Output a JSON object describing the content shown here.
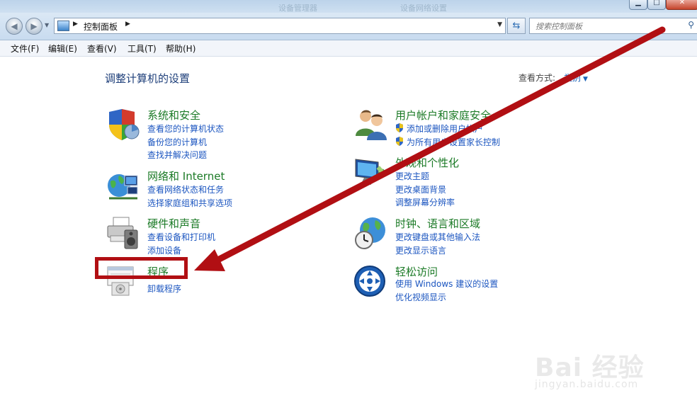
{
  "titlebar": {
    "ghost_left": "设备管理器",
    "ghost_right": "设备网络设置"
  },
  "address": {
    "crumb": "控制面板",
    "search_placeholder": "搜索控制面板"
  },
  "menus": [
    "文件(F)",
    "编辑(E)",
    "查看(V)",
    "工具(T)",
    "帮助(H)"
  ],
  "page": {
    "title": "调整计算机的设置",
    "view_by_label": "查看方式:",
    "view_by_value": "类别"
  },
  "categories": [
    {
      "title": "系统和安全",
      "icon": "shield-icon",
      "links": [
        {
          "text": "查看您的计算机状态"
        },
        {
          "text": "备份您的计算机"
        },
        {
          "text": "查找并解决问题"
        }
      ]
    },
    {
      "title": "网络和 Internet",
      "icon": "network-globe-icon",
      "links": [
        {
          "text": "查看网络状态和任务"
        },
        {
          "text": "选择家庭组和共享选项"
        }
      ]
    },
    {
      "title": "硬件和声音",
      "icon": "printer-speaker-icon",
      "links": [
        {
          "text": "查看设备和打印机"
        },
        {
          "text": "添加设备"
        }
      ]
    },
    {
      "title": "程序",
      "icon": "programs-icon",
      "links": [
        {
          "text": "卸载程序"
        }
      ]
    },
    {
      "title": "用户帐户和家庭安全",
      "icon": "users-icon",
      "links": [
        {
          "text": "添加或删除用户帐户",
          "shield": true
        },
        {
          "text": "为所有用户设置家长控制",
          "shield": true
        }
      ]
    },
    {
      "title": "外观和个性化",
      "icon": "display-icon",
      "links": [
        {
          "text": "更改主题"
        },
        {
          "text": "更改桌面背景"
        },
        {
          "text": "调整屏幕分辨率"
        }
      ]
    },
    {
      "title": "时钟、语言和区域",
      "icon": "clock-globe-icon",
      "links": [
        {
          "text": "更改键盘或其他输入法"
        },
        {
          "text": "更改显示语言"
        }
      ]
    },
    {
      "title": "轻松访问",
      "icon": "ease-of-access-icon",
      "links": [
        {
          "text": "使用 Windows 建议的设置"
        },
        {
          "text": "优化视频显示"
        }
      ]
    }
  ],
  "colors": {
    "category_title": "#1b7a26",
    "link": "#1c56c0",
    "annotation": "#b10f13"
  },
  "watermark": {
    "brand": "Bai 经验",
    "url": "jingyan.baidu.com"
  }
}
